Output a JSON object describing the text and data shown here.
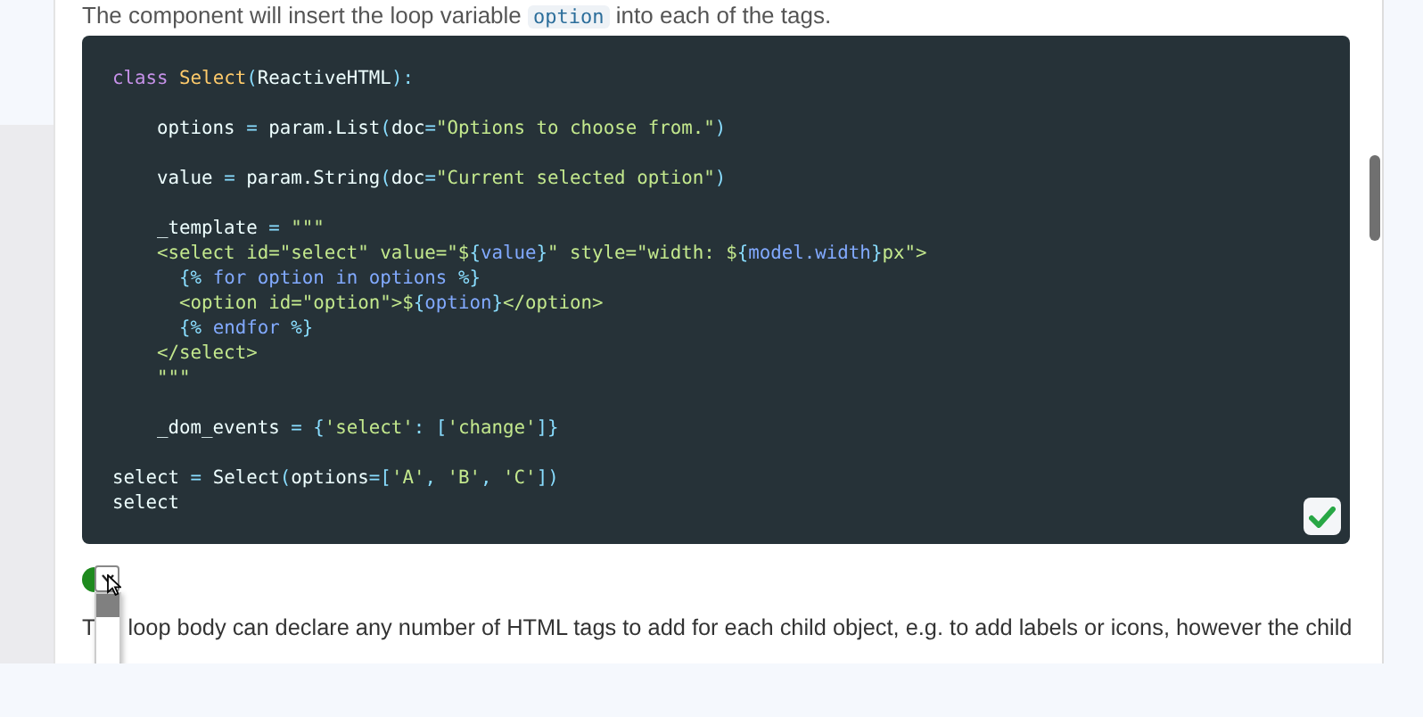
{
  "intro": {
    "before": "The component will insert the loop variable ",
    "code": "option",
    "after": " into each of the tags."
  },
  "code_block": {
    "copied": true,
    "lines": [
      {
        "kind": "code",
        "tokens": [
          {
            "kind": "kw",
            "text": "class "
          },
          {
            "kind": "cls",
            "text": "Select"
          },
          {
            "kind": "punc",
            "text": "("
          },
          {
            "kind": "plain",
            "text": "ReactiveHTML"
          },
          {
            "kind": "punc",
            "text": "):"
          }
        ]
      },
      {
        "kind": "blank"
      },
      {
        "kind": "code",
        "tokens": [
          {
            "kind": "plain",
            "text": "    options "
          },
          {
            "kind": "punc",
            "text": "="
          },
          {
            "kind": "plain",
            "text": " param.List"
          },
          {
            "kind": "punc",
            "text": "("
          },
          {
            "kind": "plain",
            "text": "doc"
          },
          {
            "kind": "punc",
            "text": "="
          },
          {
            "kind": "str",
            "text": "\"Options to choose from.\""
          },
          {
            "kind": "punc",
            "text": ")"
          }
        ]
      },
      {
        "kind": "blank"
      },
      {
        "kind": "code",
        "tokens": [
          {
            "kind": "plain",
            "text": "    value "
          },
          {
            "kind": "punc",
            "text": "="
          },
          {
            "kind": "plain",
            "text": " param.String"
          },
          {
            "kind": "punc",
            "text": "("
          },
          {
            "kind": "plain",
            "text": "doc"
          },
          {
            "kind": "punc",
            "text": "="
          },
          {
            "kind": "str",
            "text": "\"Current selected option\""
          },
          {
            "kind": "punc",
            "text": ")"
          }
        ]
      },
      {
        "kind": "blank"
      },
      {
        "kind": "code",
        "tokens": [
          {
            "kind": "plain",
            "text": "    _template "
          },
          {
            "kind": "punc",
            "text": "="
          },
          {
            "kind": "str",
            "text": " \"\"\""
          }
        ]
      },
      {
        "kind": "code",
        "tokens": [
          {
            "kind": "str",
            "text": "    <select id=\"select\" value=\"$"
          },
          {
            "kind": "punc",
            "text": "{"
          },
          {
            "kind": "var",
            "text": "value"
          },
          {
            "kind": "punc",
            "text": "}"
          },
          {
            "kind": "str",
            "text": "\" style=\"width: $"
          },
          {
            "kind": "punc",
            "text": "{"
          },
          {
            "kind": "var",
            "text": "model.width"
          },
          {
            "kind": "punc",
            "text": "}"
          },
          {
            "kind": "str",
            "text": "px\">"
          }
        ]
      },
      {
        "kind": "code",
        "tokens": [
          {
            "kind": "punc",
            "text": "      {% "
          },
          {
            "kind": "var",
            "text": "for option in options"
          },
          {
            "kind": "punc",
            "text": " %}"
          }
        ]
      },
      {
        "kind": "code",
        "tokens": [
          {
            "kind": "str",
            "text": "      <option id=\"option\">$"
          },
          {
            "kind": "punc",
            "text": "{"
          },
          {
            "kind": "var",
            "text": "option"
          },
          {
            "kind": "punc",
            "text": "}"
          },
          {
            "kind": "str",
            "text": "</option>"
          }
        ]
      },
      {
        "kind": "code",
        "tokens": [
          {
            "kind": "punc",
            "text": "      {% "
          },
          {
            "kind": "var",
            "text": "endfor"
          },
          {
            "kind": "punc",
            "text": " %}"
          }
        ]
      },
      {
        "kind": "code",
        "tokens": [
          {
            "kind": "str",
            "text": "    </select>"
          }
        ]
      },
      {
        "kind": "code",
        "tokens": [
          {
            "kind": "str",
            "text": "    \"\"\""
          }
        ]
      },
      {
        "kind": "blank"
      },
      {
        "kind": "code",
        "tokens": [
          {
            "kind": "plain",
            "text": "    _dom_events "
          },
          {
            "kind": "punc",
            "text": "= {"
          },
          {
            "kind": "str",
            "text": "'select'"
          },
          {
            "kind": "punc",
            "text": ": ["
          },
          {
            "kind": "str",
            "text": "'change'"
          },
          {
            "kind": "punc",
            "text": "]}"
          }
        ]
      },
      {
        "kind": "blank"
      },
      {
        "kind": "code",
        "tokens": [
          {
            "kind": "plain",
            "text": "select "
          },
          {
            "kind": "punc",
            "text": "="
          },
          {
            "kind": "plain",
            "text": " Select"
          },
          {
            "kind": "punc",
            "text": "("
          },
          {
            "kind": "plain",
            "text": "options"
          },
          {
            "kind": "punc",
            "text": "=["
          },
          {
            "kind": "str",
            "text": "'A'"
          },
          {
            "kind": "punc",
            "text": ", "
          },
          {
            "kind": "str",
            "text": "'B'"
          },
          {
            "kind": "punc",
            "text": ", "
          },
          {
            "kind": "str",
            "text": "'C'"
          },
          {
            "kind": "punc",
            "text": "])"
          }
        ]
      },
      {
        "kind": "code",
        "tokens": [
          {
            "kind": "plain",
            "text": "select"
          }
        ]
      }
    ]
  },
  "select_widget": {
    "expanded": true
  },
  "paragraph": {
    "before": "T",
    "after": "loop body can declare any number of HTML tags to add for each child object, e.g. to add labels or icons, however the child"
  }
}
